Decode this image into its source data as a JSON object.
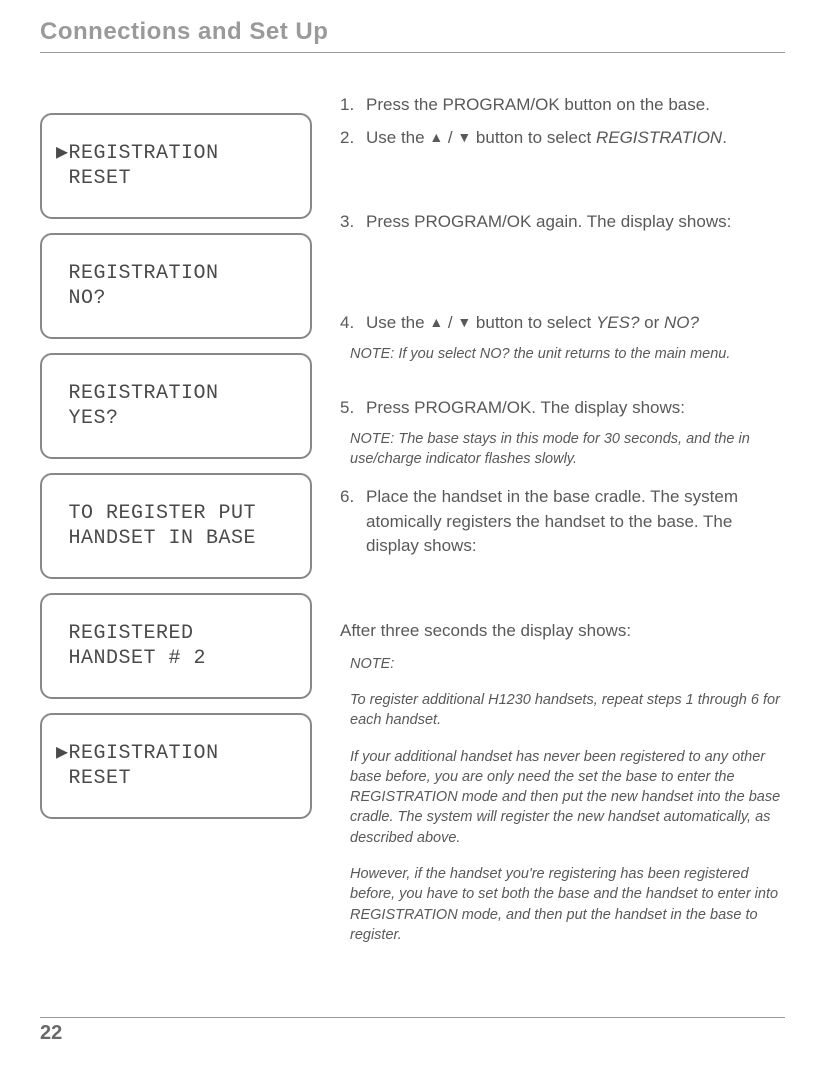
{
  "header": {
    "title": "Connections and Set Up"
  },
  "lcd": {
    "box1_line1": "▶REGISTRATION",
    "box1_line2": " RESET",
    "box2_line1": " REGISTRATION",
    "box2_line2": " NO?",
    "box3_line1": " REGISTRATION",
    "box3_line2": " YES?",
    "box4_line1": " TO REGISTER PUT",
    "box4_line2": " HANDSET IN BASE",
    "box5_line1": " REGISTERED",
    "box5_line2": " HANDSET # 2",
    "box6_line1": "▶REGISTRATION",
    "box6_line2": " RESET"
  },
  "steps": {
    "s1_num": "1.",
    "s1_text": "Press the PROGRAM/OK button on the base.",
    "s2_num": "2.",
    "s2_pre": "Use the ",
    "s2_post": " button to select ",
    "s2_ital": "REGISTRATION",
    "s2_end": ".",
    "s3_num": "3.",
    "s3_text": "Press PROGRAM/OK again. The display shows:",
    "s4_num": "4.",
    "s4_pre": "Use the ",
    "s4_post": " button to select ",
    "s4_ital1": "YES?",
    "s4_or": " or ",
    "s4_ital2": "NO?",
    "s5_num": "5.",
    "s5_text": "Press PROGRAM/OK. The display shows:",
    "s6_num": "6.",
    "s6_text": "Place the handset in the base cradle. The system atomically registers the handset to the base. The display shows:"
  },
  "notes": {
    "n4": "NOTE: If you select NO? the unit returns to the main menu.",
    "n5": "NOTE: The base stays in this mode for 30 seconds, and the in use/charge indicator flashes slowly.",
    "after": "After three seconds the display shows:",
    "n_final_label": "NOTE:",
    "n_final_p1": "To register additional H1230 handsets, repeat steps 1 through 6 for each handset.",
    "n_final_p2": "If your additional handset has never been registered to any other base before, you are only need the set the base to enter the REGISTRATION mode and then put the new handset into the base cradle. The system will register the new handset automatically, as described above.",
    "n_final_p3": "However, if the handset you're registering has been registered before, you have to set both the base and the handset to enter into REGISTRATION mode, and then put the handset in the base to register."
  },
  "arrows": {
    "up": "▲",
    "sep": " / ",
    "down": "▼"
  },
  "footer": {
    "page": "22"
  }
}
